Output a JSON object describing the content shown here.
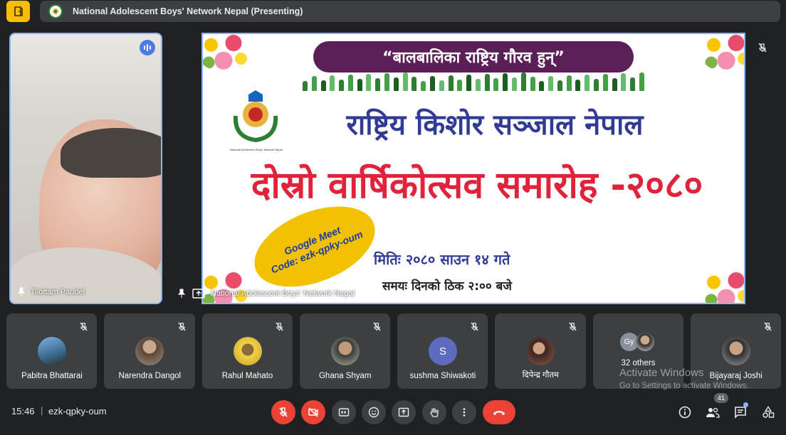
{
  "header": {
    "presenting_title": "National Adolescent Boys' Network Nepal (Presenting)"
  },
  "self_tile": {
    "name": "Tilottam Paudel",
    "speaking": true
  },
  "presentation_tile": {
    "presenter_label": "National Adolescent Boys' Network Nepal",
    "slide": {
      "banner": "“बालबालिका राष्ट्रिय गौरव हुन्”",
      "emblem_caption": "National Adolescent Boys' Network Nepal",
      "title_line1": "राष्ट्रिय किशोर सञ्जाल नेपाल",
      "title_line2": "दोस्रो वार्षिकोत्सव समारोह -२०८०",
      "badge_line1": "Google Meet",
      "badge_line2": "Code: ezk-qpky-oum",
      "date_line": "मितिः २०८० साउन १४ गते",
      "time_line": "समयः दिनको ठिक २:०० बजे"
    }
  },
  "participants": [
    {
      "name": "Pabitra Bhattarai",
      "avatar_color": "#5f8fb4",
      "muted": true
    },
    {
      "name": "Narendra Dangol",
      "avatar_color": "#7d6a5a",
      "muted": true
    },
    {
      "name": "Rahul Mahato",
      "avatar_color": "#d7b63a",
      "muted": true
    },
    {
      "name": "Ghana Shyam",
      "avatar_color": "#8a9a7a",
      "muted": true
    },
    {
      "name": "sushma Shiwakoti",
      "initial": "S",
      "avatar_color": "#5c6bc0",
      "muted": true
    },
    {
      "name": "दिपेन्द्र गौतम",
      "avatar_color": "#6d4c41",
      "muted": true
    },
    {
      "others_label": "32 others",
      "mini_initials": "Gy",
      "mini_color": "#8a9099"
    },
    {
      "name": "Bijayaraj Joshi",
      "avatar_color": "#9e8a78",
      "muted": true
    }
  ],
  "watermark": {
    "line1": "Activate Windows",
    "line2": "Go to Settings to activate Windows."
  },
  "bottom_bar": {
    "time": "15:46",
    "separator": "|",
    "meeting_code": "ezk-qpky-oum",
    "people_count": "41"
  },
  "colors": {
    "background": "#202124",
    "tile": "#3c4043",
    "danger": "#ea4335",
    "accent": "#8ab4f8",
    "app_icon": "#fbbc04"
  }
}
